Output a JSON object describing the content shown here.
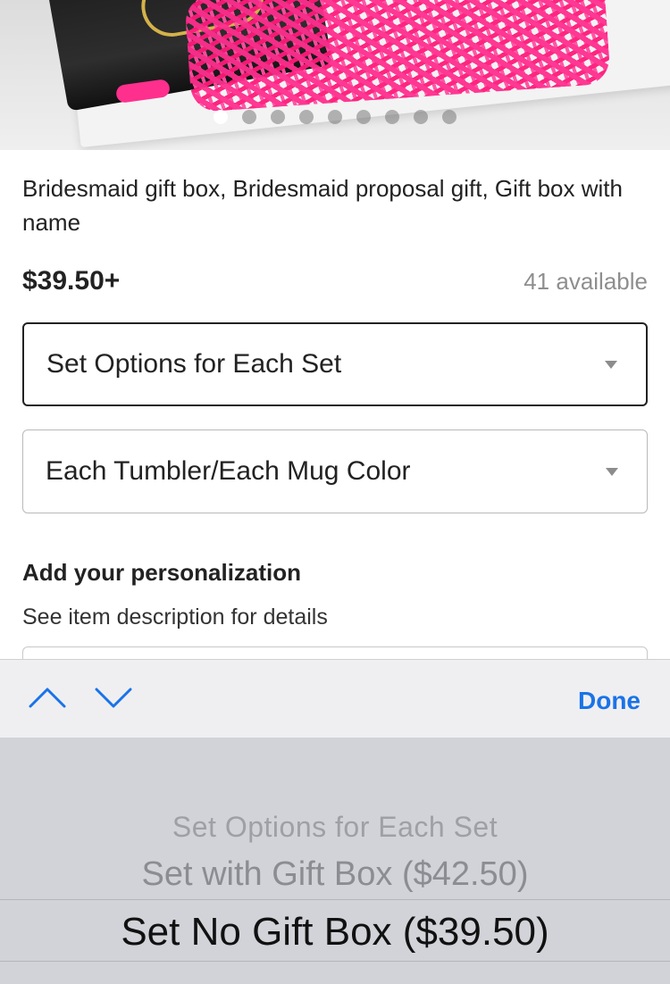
{
  "product": {
    "title": "Bridesmaid gift box, Bridesmaid proposal gift, Gift box with name",
    "price": "$39.50+",
    "availability": "41 available",
    "image_count": 9,
    "image_active_index": 0
  },
  "options": {
    "select_1_value": "Set Options for Each Set",
    "select_2_value": "Each Tumbler/Each Mug Color"
  },
  "personalization": {
    "heading": "Add your personalization",
    "subtext": "See item description for details"
  },
  "toolbar": {
    "prev_icon": "chevron-up-icon",
    "next_icon": "chevron-down-icon",
    "done_label": "Done",
    "accent_color": "#1a73e8"
  },
  "picker": {
    "options": [
      "Set Options for Each Set",
      "Set with Gift Box ($42.50)",
      "Set No Gift Box ($39.50)"
    ],
    "selected_index": 2
  }
}
